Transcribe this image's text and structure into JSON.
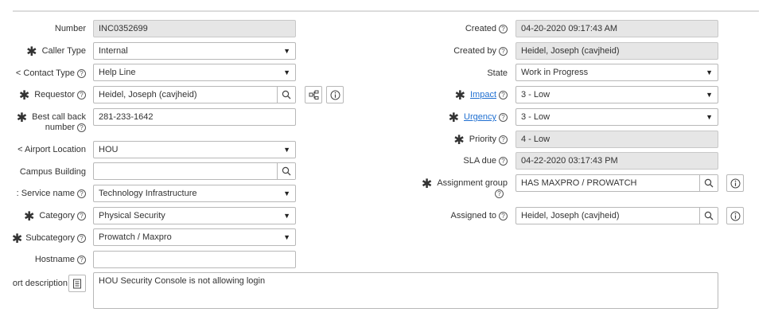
{
  "left": {
    "number": {
      "label": "Number",
      "value": "INC0352699"
    },
    "caller_type": {
      "label": "Caller Type",
      "value": "Internal"
    },
    "contact_type": {
      "label": "< Contact Type",
      "value": "Help Line"
    },
    "requestor": {
      "label": "Requestor",
      "value": "Heidel, Joseph  (cavjheid)"
    },
    "best_call_back": {
      "label": "Best call back number",
      "value": "281-233-1642"
    },
    "airport_location": {
      "label": "< Airport Location",
      "value": "HOU"
    },
    "campus_building": {
      "label": "Campus Building",
      "value": ""
    },
    "service_name": {
      "label": ": Service name",
      "value": "Technology Infrastructure"
    },
    "category": {
      "label": "Category",
      "value": "Physical Security"
    },
    "subcategory": {
      "label": "Subcategory",
      "value": "Prowatch / Maxpro"
    },
    "hostname": {
      "label": "Hostname",
      "value": ""
    }
  },
  "right": {
    "created": {
      "label": "Created",
      "value": "04-20-2020 09:17:43 AM"
    },
    "created_by": {
      "label": "Created by",
      "value": "Heidel, Joseph  (cavjheid)"
    },
    "state": {
      "label": "State",
      "value": "Work in Progress"
    },
    "impact": {
      "label": "Impact",
      "value": "3 - Low"
    },
    "urgency": {
      "label": "Urgency",
      "value": "3 - Low"
    },
    "priority": {
      "label": "Priority",
      "value": "4 - Low"
    },
    "sla_due": {
      "label": "SLA due",
      "value": "04-22-2020 03:17:43 PM"
    },
    "assignment_group": {
      "label": "Assignment group",
      "value": "HAS MAXPRO / PROWATCH"
    },
    "assigned_to": {
      "label": "Assigned to",
      "value": "Heidel, Joseph  (cavjheid)"
    }
  },
  "short_description": {
    "label": "ort description",
    "value": "HOU Security Console is not allowing login"
  },
  "icons": {
    "help": "?",
    "dropdown": "▼",
    "required": "✱"
  }
}
